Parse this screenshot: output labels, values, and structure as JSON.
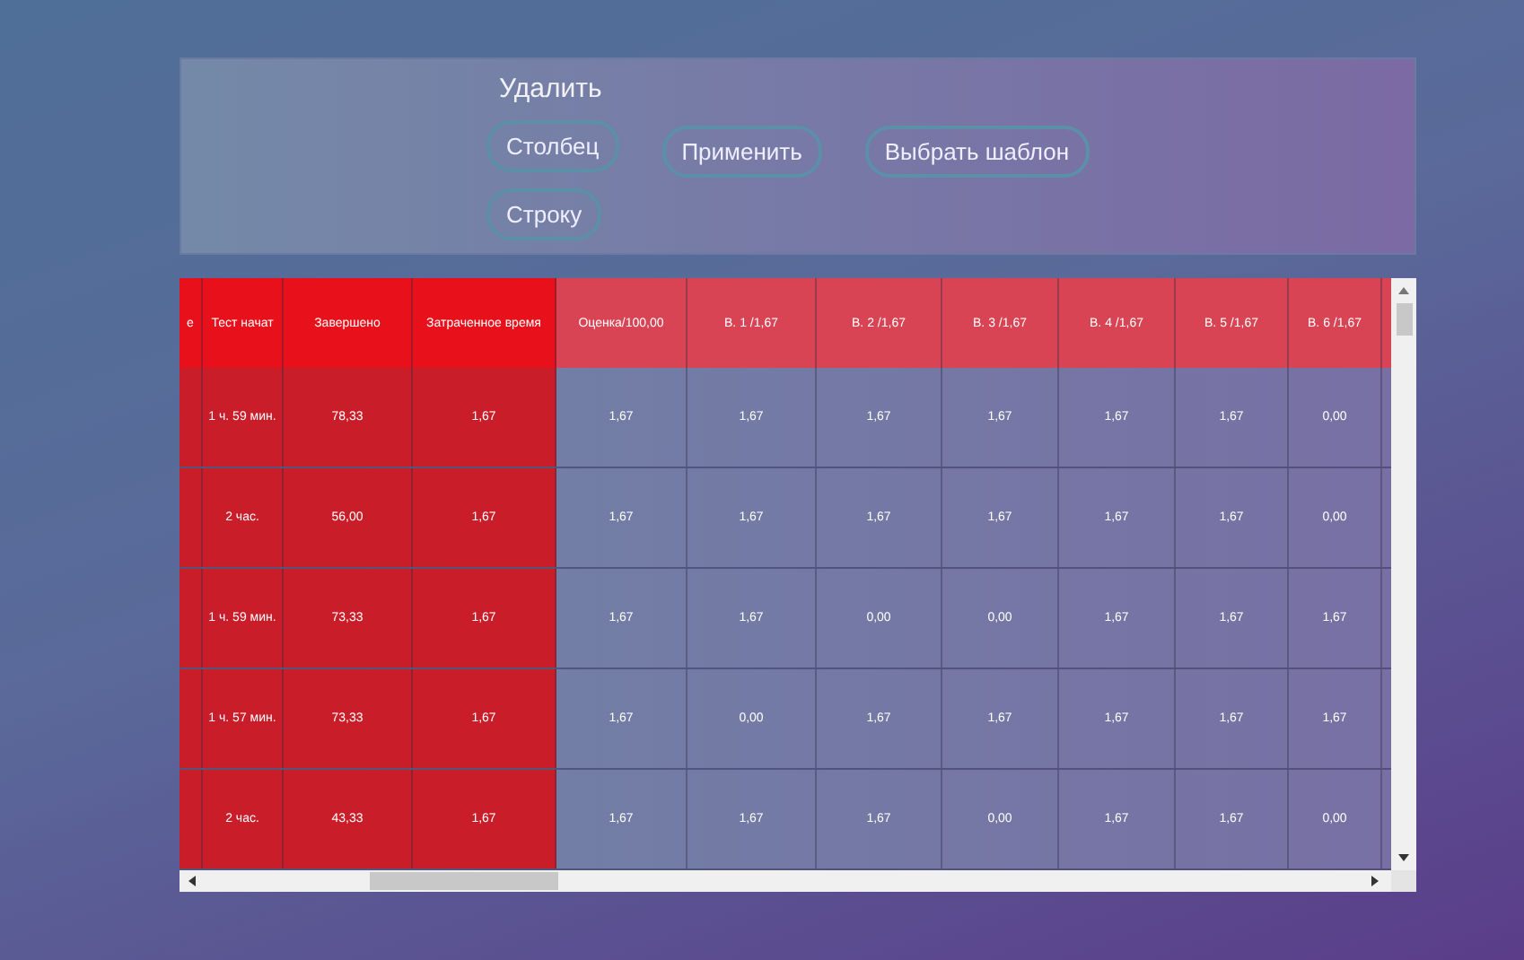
{
  "toolbar": {
    "delete_label": "Удалить",
    "buttons": [
      {
        "label": "Столбец",
        "kind": "delete"
      },
      {
        "label": "Применить",
        "kind": "action"
      },
      {
        "label": "Выбрать шаблон",
        "kind": "action"
      },
      {
        "label": "Строку",
        "kind": "delete"
      }
    ]
  },
  "table": {
    "columns": [
      {
        "label": "е",
        "kind": "fixed"
      },
      {
        "label": "Тест начат",
        "kind": "fixed"
      },
      {
        "label": "Завершено",
        "kind": "fixed"
      },
      {
        "label": "Затраченное время",
        "kind": "fixed"
      },
      {
        "label": "Оценка/100,00",
        "kind": "grade"
      },
      {
        "label": "В. 1 /1,67",
        "kind": "grade"
      },
      {
        "label": "В. 2 /1,67",
        "kind": "grade"
      },
      {
        "label": "В. 3 /1,67",
        "kind": "grade"
      },
      {
        "label": "В. 4 /1,67",
        "kind": "grade"
      },
      {
        "label": "В. 5 /1,67",
        "kind": "grade"
      },
      {
        "label": "В. 6 /1,67",
        "kind": "grade"
      }
    ],
    "rows": [
      {
        "cells": [
          "",
          "1 ч. 59 мин.",
          "78,33",
          "1,67",
          "1,67",
          "1,67",
          "1,67",
          "1,67",
          "1,67",
          "1,67",
          "0,00"
        ]
      },
      {
        "cells": [
          "",
          "2 час.",
          "56,00",
          "1,67",
          "1,67",
          "1,67",
          "1,67",
          "1,67",
          "1,67",
          "1,67",
          "0,00"
        ]
      },
      {
        "cells": [
          "",
          "1 ч. 59 мин.",
          "73,33",
          "1,67",
          "1,67",
          "1,67",
          "0,00",
          "0,00",
          "1,67",
          "1,67",
          "1,67"
        ]
      },
      {
        "cells": [
          "",
          "1 ч. 57 мин.",
          "73,33",
          "1,67",
          "1,67",
          "0,00",
          "1,67",
          "1,67",
          "1,67",
          "1,67",
          "1,67"
        ]
      },
      {
        "cells": [
          "",
          "2 час.",
          "43,33",
          "1,67",
          "1,67",
          "1,67",
          "1,67",
          "0,00",
          "1,67",
          "1,67",
          "0,00"
        ]
      }
    ]
  }
}
